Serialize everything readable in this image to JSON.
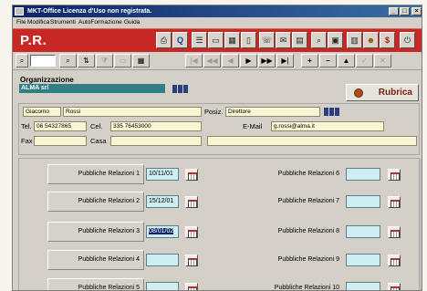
{
  "window": {
    "title": "MKT-Office     Licenza d'Uso non registrata."
  },
  "controls": {
    "min": "_",
    "max": "□",
    "close": "×"
  },
  "menu": [
    "File",
    "Modifica",
    "Strumenti",
    "AutoFormazione",
    "Guida"
  ],
  "module": {
    "label": "P.R."
  },
  "toolbar_icons": [
    "print-icon",
    "search-q-icon",
    "list-icon",
    "card-icon",
    "grid-icon",
    "document-icon",
    "phone-icon",
    "fax-icon",
    "chart-icon",
    "zoom-icon",
    "calc-icon",
    "book-icon",
    "people-icon",
    "dollar-icon",
    "power-icon"
  ],
  "nav_glyphs": {
    "first": "|◀",
    "prev_page": "◀◀",
    "prev": "◀",
    "next": "▶",
    "next_page": "▶▶",
    "last": "▶|",
    "add": "+",
    "remove": "−",
    "up": "▲",
    "check": "✓",
    "cancel": "✕"
  },
  "organization": {
    "label": "Organizzazione",
    "value": "ALMA srl"
  },
  "rubrica": {
    "label": "Rubrica"
  },
  "contact": {
    "first_name": "Giacomo",
    "last_name": "Rossi",
    "posiz_label": "Posiz.",
    "posiz_value": "Direttore",
    "tel_label": "Tel.",
    "tel_value": "06 54327865",
    "cel_label": "Cel.",
    "cel_value": "335 76453000",
    "email_label": "E-Mail",
    "email_value": "g.rossi@alma.it",
    "fax_label": "Fax",
    "fax_value": "",
    "casa_label": "Casa",
    "casa_value": "",
    "extra_value": ""
  },
  "pr_left": [
    {
      "label": "Pubbliche Relazioni 1",
      "date": "10/11/01"
    },
    {
      "label": "Pubbliche Relazioni 2",
      "date": "15/12/01"
    },
    {
      "label": "Pubbliche Relazioni 3",
      "date": "08/01/02"
    },
    {
      "label": "Pubbliche Relazioni 4",
      "date": ""
    },
    {
      "label": "Pubbliche Relazioni 5",
      "date": ""
    }
  ],
  "pr_right": [
    {
      "label": "Pubbliche Relazioni 6",
      "date": ""
    },
    {
      "label": "Pubbliche Relazioni 7",
      "date": ""
    },
    {
      "label": "Pubbliche Relazioni 8",
      "date": ""
    },
    {
      "label": "Pubbliche Relazioni 9",
      "date": ""
    },
    {
      "label": "Pubbliche Relazioni 10",
      "date": ""
    }
  ],
  "colors": {
    "accent_red": "#c82825",
    "org_teal": "#2f7f84",
    "field_yellow": "#fbf7d6",
    "date_blue": "#cfeef4",
    "title_blue": "#0a246a"
  }
}
